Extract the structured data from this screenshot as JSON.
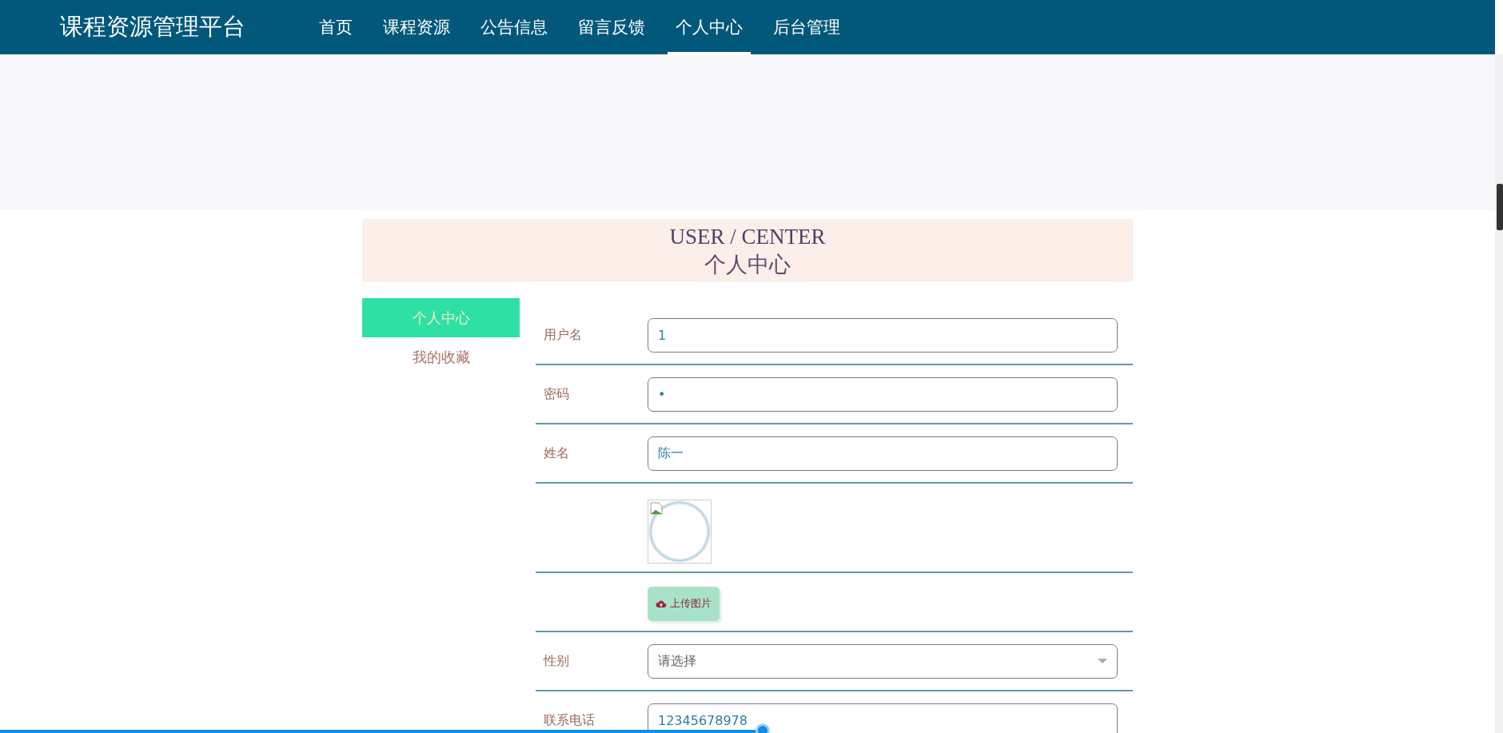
{
  "header": {
    "title": "课程资源管理平台",
    "nav": [
      {
        "label": "首页",
        "selected": false
      },
      {
        "label": "课程资源",
        "selected": false
      },
      {
        "label": "公告信息",
        "selected": false
      },
      {
        "label": "留言反馈",
        "selected": false
      },
      {
        "label": "个人中心",
        "selected": true
      },
      {
        "label": "后台管理",
        "selected": false
      }
    ]
  },
  "section_title": {
    "english": "USER / CENTER",
    "chinese": "个人中心"
  },
  "sidebar": {
    "items": [
      {
        "label": "个人中心",
        "selected": true
      },
      {
        "label": "我的收藏",
        "selected": false
      }
    ]
  },
  "form": {
    "rows": [
      {
        "kind": "text",
        "label": "用户名",
        "value": "1"
      },
      {
        "kind": "password",
        "label": "密码",
        "value": "•"
      },
      {
        "kind": "text",
        "label": "姓名",
        "value": "陈一"
      },
      {
        "kind": "image"
      },
      {
        "kind": "upload",
        "button": "上传图片"
      },
      {
        "kind": "select",
        "label": "性别",
        "placeholder": "请选择"
      },
      {
        "kind": "text",
        "label": "联系电话",
        "value": "12345678978"
      }
    ]
  },
  "progress": {
    "level": 0.51
  }
}
